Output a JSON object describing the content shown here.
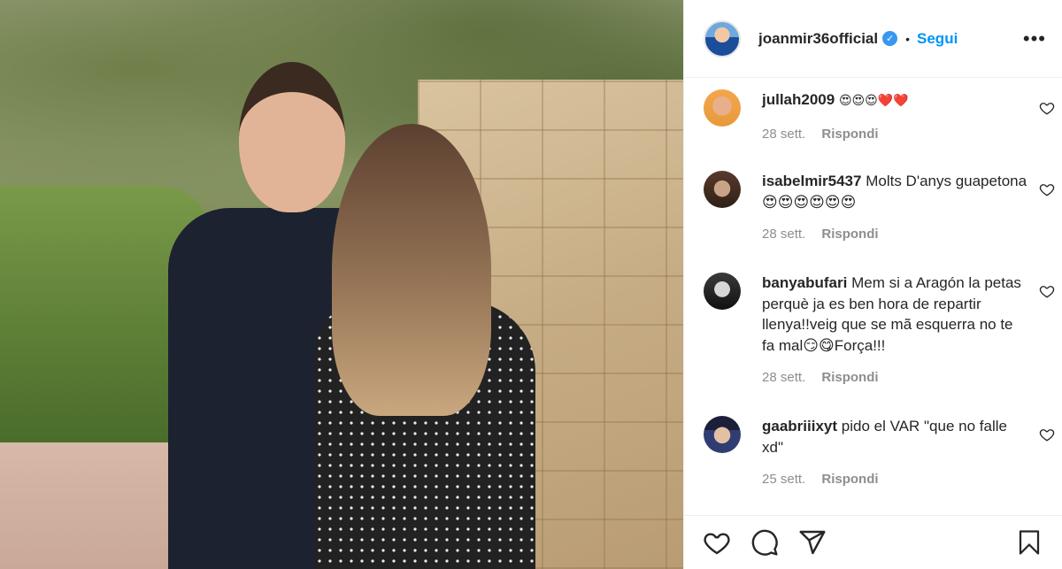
{
  "post": {
    "owner_username": "joanmir36official",
    "separator": "•",
    "follow_label": "Segui",
    "more_label": "•••"
  },
  "comments": [
    {
      "username": "jullah2009",
      "text": "😍😍😍❤️❤️",
      "time": "28 sett.",
      "reply_label": "Rispondi"
    },
    {
      "username": "isabelmir5437",
      "text": "Molts D'anys guapetona 😍😍😍😍😍😍",
      "time": "28 sett.",
      "reply_label": "Rispondi"
    },
    {
      "username": "banyabufari",
      "text": "Mem si a Aragón la petas perquè ja es ben hora de repartir llenya!!veig que se mã esquerra no te fa mal😏😋Força!!!",
      "time": "28 sett.",
      "reply_label": "Rispondi"
    },
    {
      "username": "gaabriiixyt",
      "text": "pido el VAR \"que no falle xd\"",
      "time": "25 sett.",
      "reply_label": "Rispondi"
    }
  ],
  "icons": {
    "verified": "verified-badge-icon",
    "like": "heart-icon",
    "comment": "comment-icon",
    "share": "share-icon",
    "save": "bookmark-icon",
    "more": "more-options-icon"
  },
  "colors": {
    "link": "#0095f6",
    "verified": "#3897f0",
    "secondary_text": "#8e8e8e"
  }
}
